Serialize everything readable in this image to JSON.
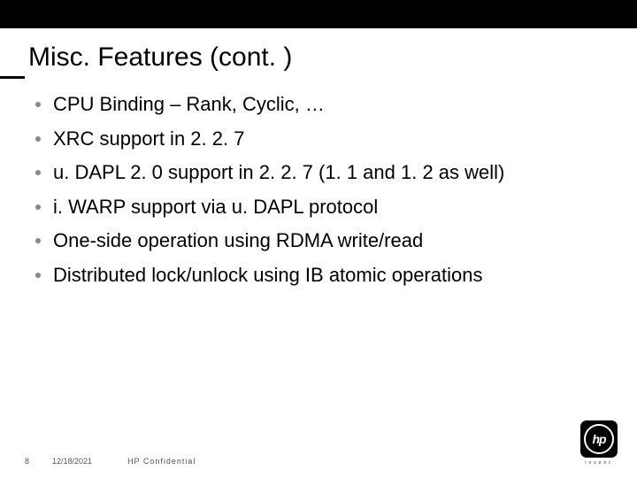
{
  "title": "Misc. Features (cont. )",
  "bullets": [
    "CPU Binding – Rank, Cyclic, …",
    "XRC support in 2. 2. 7",
    "u. DAPL 2. 0 support in 2. 2. 7 (1. 1 and 1. 2 as well)",
    "i. WARP support via u. DAPL protocol",
    "One-side operation using RDMA write/read",
    "Distributed lock/unlock using IB atomic operations"
  ],
  "footer": {
    "page": "8",
    "date": "12/18/2021",
    "confidential": "HP Confidential"
  },
  "logo": {
    "text": "hp",
    "sub": "invent"
  }
}
